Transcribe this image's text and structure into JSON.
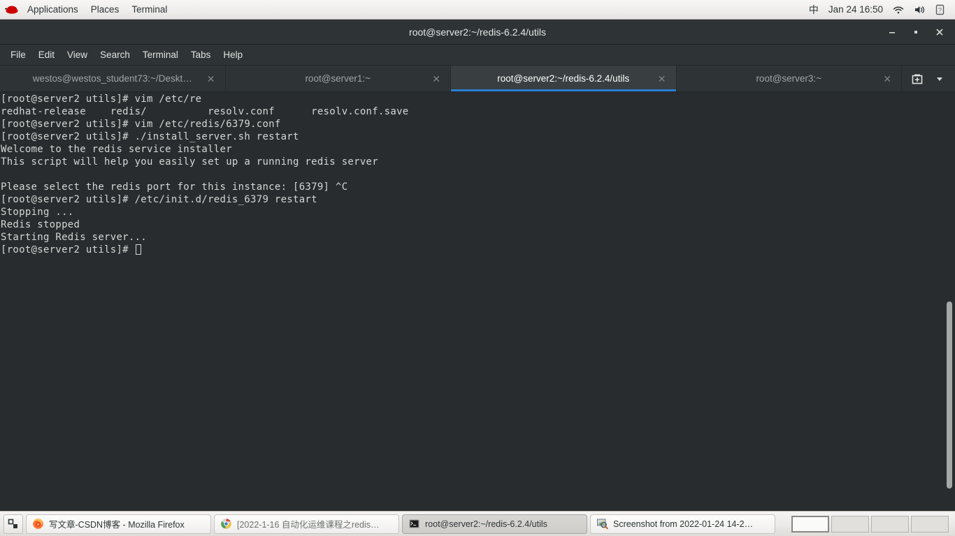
{
  "top_panel": {
    "logo_name": "redhat-logo",
    "menus": [
      "Applications",
      "Places",
      "Terminal"
    ],
    "ime_label": "中",
    "clock": "Jan 24  16:50",
    "tray_icons": [
      "wifi-icon",
      "volume-icon",
      "battery-icon"
    ]
  },
  "window": {
    "title": "root@server2:~/redis-6.2.4/utils",
    "controls": {
      "minimize": "–",
      "maximize": "■",
      "close": "✕"
    }
  },
  "menubar": {
    "items": [
      "File",
      "Edit",
      "View",
      "Search",
      "Terminal",
      "Tabs",
      "Help"
    ]
  },
  "tabs": [
    {
      "label": "westos@westos_student73:~/Deskt…",
      "active": false,
      "close": "✕"
    },
    {
      "label": "root@server1:~",
      "active": false,
      "close": "✕"
    },
    {
      "label": "root@server2:~/redis-6.2.4/utils",
      "active": true,
      "close": "✕"
    },
    {
      "label": "root@server3:~",
      "active": false,
      "close": "✕"
    }
  ],
  "tab_tools": {
    "new_tab_icon": "new-tab-icon",
    "tab_list_icon": "chevron-down-icon"
  },
  "terminal": {
    "prompt": "[root@server2 utils]#",
    "lines": [
      "[root@server2 utils]# vim /etc/re",
      "redhat-release    redis/          resolv.conf      resolv.conf.save",
      "[root@server2 utils]# vim /etc/redis/6379.conf",
      "[root@server2 utils]# ./install_server.sh restart",
      "Welcome to the redis service installer",
      "This script will help you easily set up a running redis server",
      "",
      "Please select the redis port for this instance: [6379] ^C",
      "[root@server2 utils]# /etc/init.d/redis_6379 restart",
      "Stopping ...",
      "Redis stopped",
      "Starting Redis server..."
    ],
    "last_line": "[root@server2 utils]# ",
    "colors": {
      "background": "#282c2e",
      "foreground": "#d6d6d6"
    }
  },
  "taskbar": {
    "show_desktop_icon": "show-desktop-icon",
    "items": [
      {
        "label": "写文章-CSDN博客 - Mozilla Firefox",
        "icon": "firefox-icon",
        "active": false,
        "dim": false
      },
      {
        "label": "[2022-1-16 自动化运维课程之redis…",
        "icon": "chrome-icon",
        "active": false,
        "dim": true
      },
      {
        "label": "root@server2:~/redis-6.2.4/utils",
        "icon": "terminal-icon",
        "active": true,
        "dim": false
      },
      {
        "label": "Screenshot from 2022-01-24 14-2…",
        "icon": "image-viewer-icon",
        "active": false,
        "dim": false
      }
    ],
    "workspaces": [
      {
        "active": true
      },
      {
        "active": false
      },
      {
        "active": false
      },
      {
        "active": false
      }
    ]
  }
}
